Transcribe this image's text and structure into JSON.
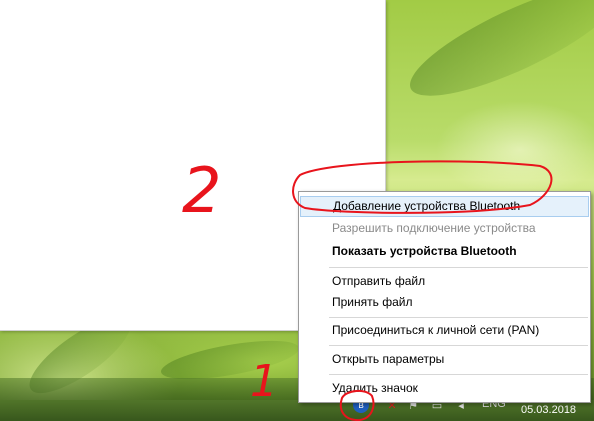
{
  "context_menu": {
    "items": [
      {
        "label": "Добавление устройства Bluetooth"
      },
      {
        "label": "Разрешить подключение устройства"
      },
      {
        "label": "Показать устройства Bluetooth"
      },
      {
        "label": "Отправить файл"
      },
      {
        "label": "Принять файл"
      },
      {
        "label": "Присоединиться к личной сети (PAN)"
      },
      {
        "label": "Открыть параметры"
      },
      {
        "label": "Удалить значок"
      }
    ]
  },
  "taskbar": {
    "language": "ENG",
    "date": "05.03.2018"
  },
  "annotations": {
    "label_1": "1",
    "label_2": "2"
  },
  "colors": {
    "annotation": "#e8141c",
    "menu_highlight": "#e5f1fb",
    "menu_highlight_border": "#a8cdef"
  }
}
